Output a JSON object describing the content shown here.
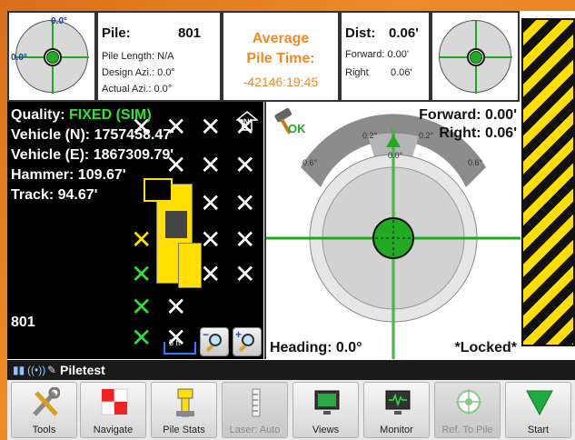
{
  "left_mini": {
    "label_top": "0.0°",
    "label_left": "0.0°"
  },
  "pile_info": {
    "pile_label": "Pile:",
    "pile_number": "801",
    "pile_length": "Pile Length: N/A",
    "design_azi": "Design Azi.: 0.0°",
    "actual_azi": "Actual Azi.: 0.0°"
  },
  "average": {
    "line1": "Average",
    "line2": "Pile Time:",
    "value": "-42146:19:45"
  },
  "dist": {
    "label": "Dist:",
    "value": "0.06'",
    "forward": "Forward: 0.00'",
    "right_label": "Right",
    "right_value": "0.06'"
  },
  "machine": {
    "quality_label": "Quality:",
    "quality_value": "FIXED (SIM)",
    "vehicle_n": "Vehicle (N): 1757458.47'",
    "vehicle_e": "Vehicle (E): 1867309.79'",
    "hammer": "Hammer: 109.67'",
    "track": "Track: 94.67'",
    "pile_id": "801",
    "scale": "5 ft",
    "north": "N"
  },
  "target": {
    "ok": "OK",
    "forward": "Forward: 0.00'",
    "right": "Right: 0.06'",
    "heading": "Heading: 0.0°",
    "locked": "*Locked*",
    "arc_left": "0.6°",
    "arc_mid_left": "0.2°",
    "arc_center": "0.0°",
    "arc_mid_right": "0.2°",
    "arc_right": "0.6°"
  },
  "status": {
    "project": "Piletest"
  },
  "toolbar": [
    {
      "label": "Tools",
      "icon": "tools-icon"
    },
    {
      "label": "Navigate",
      "icon": "navigate-icon"
    },
    {
      "label": "Pile Stats",
      "icon": "pile-stats-icon"
    },
    {
      "label": "Laser: Auto",
      "icon": "laser-icon"
    },
    {
      "label": "Views",
      "icon": "views-icon"
    },
    {
      "label": "Monitor",
      "icon": "monitor-icon"
    },
    {
      "label": "Ref. To Pile",
      "icon": "ref-to-pile-icon"
    },
    {
      "label": "Start",
      "icon": "start-icon"
    }
  ],
  "colors": {
    "accent_orange": "#f08a28",
    "green": "#22aa22",
    "hazard_yellow": "#ffde00"
  }
}
